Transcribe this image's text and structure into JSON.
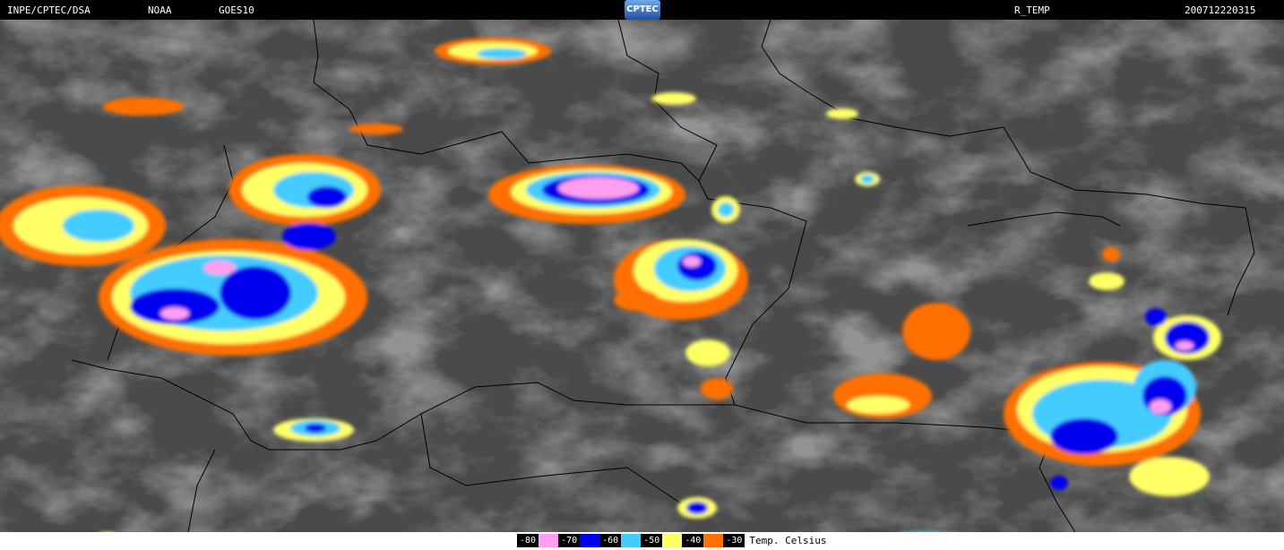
{
  "header": {
    "agency": "INPE/CPTEC/DSA",
    "provider": "NOAA",
    "satellite": "GOES10",
    "logo": "CPTEC",
    "product": "R_TEMP",
    "timestamp": "200712220315"
  },
  "legend": {
    "items": [
      {
        "label": "-80",
        "color": "#ff9ff0"
      },
      {
        "label": "-70",
        "color": "#0000ee"
      },
      {
        "label": "-60",
        "color": "#44ccff"
      },
      {
        "label": "-50",
        "color": "#ffff66"
      },
      {
        "label": "-40",
        "color": "#ff7000"
      },
      {
        "label": "-30",
        "color": ""
      }
    ],
    "unit": "Temp. Celsius"
  }
}
